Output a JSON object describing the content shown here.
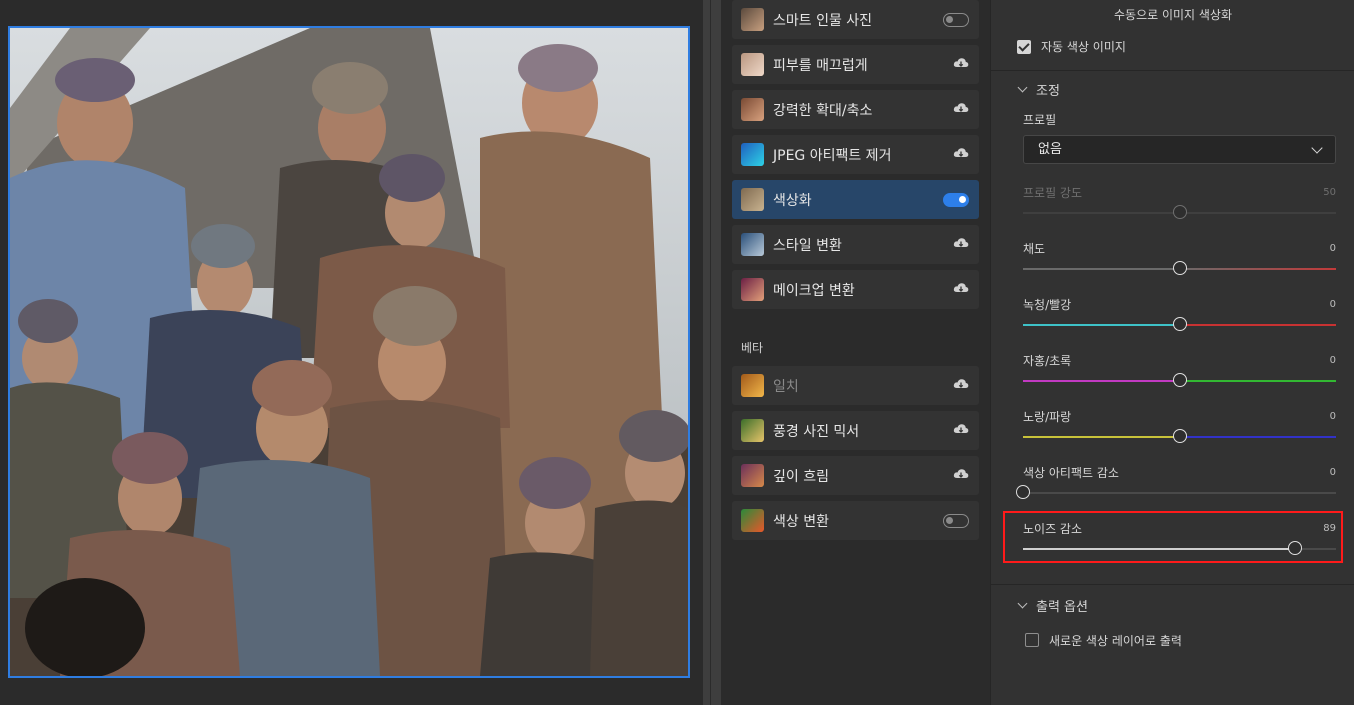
{
  "filters": [
    {
      "label": "스마트 인물 사진",
      "control": "toggle",
      "on": false,
      "thumb": [
        "#5b4a3d",
        "#c8a080"
      ]
    },
    {
      "label": "피부를 매끄럽게",
      "control": "cloud",
      "thumb": [
        "#b99680",
        "#efd9c9"
      ]
    },
    {
      "label": "강력한 확대/축소",
      "control": "cloud",
      "thumb": [
        "#7a4a34",
        "#d9a27f"
      ]
    },
    {
      "label": "JPEG 아티팩트 제거",
      "control": "cloud",
      "thumb": [
        "#1f5fbf",
        "#2ed2e6"
      ]
    },
    {
      "label": "색상화",
      "control": "toggle",
      "on": true,
      "active": true,
      "thumb": [
        "#7f6a50",
        "#c9b390"
      ]
    },
    {
      "label": "스타일 변환",
      "control": "cloud",
      "thumb": [
        "#2a4f7a",
        "#b8c9d8"
      ]
    },
    {
      "label": "메이크업 변환",
      "control": "cloud",
      "thumb": [
        "#6b1f44",
        "#e3a07a"
      ]
    }
  ],
  "beta_label": "베타",
  "beta_filters": [
    {
      "label": "일치",
      "control": "cloud",
      "disabled": true,
      "thumb": [
        "#a25a1a",
        "#f2b74a"
      ]
    },
    {
      "label": "풍경 사진 믹서",
      "control": "cloud",
      "thumb": [
        "#3b6e2a",
        "#e7c46a"
      ]
    },
    {
      "label": "깊이 흐림",
      "control": "cloud",
      "thumb": [
        "#6b2f5a",
        "#d78a4a"
      ]
    },
    {
      "label": "색상 변환",
      "control": "toggle",
      "on": false,
      "thumb": [
        "#2a8a3a",
        "#e8572a"
      ]
    }
  ],
  "panel": {
    "title": "수동으로 이미지 색상화",
    "auto_color_label": "자동 색상 이미지",
    "adjust_section": "조정",
    "profile_label": "프로필",
    "profile_value": "없음",
    "sliders": [
      {
        "label": "프로필 강도",
        "value": "50",
        "pos": 0.5,
        "disabled": true,
        "track": "plain"
      },
      {
        "label": "채도",
        "value": "0",
        "pos": 0.5,
        "track": "saturation"
      },
      {
        "label": "녹청/빨강",
        "value": "0",
        "pos": 0.5,
        "track": "cyan-red"
      },
      {
        "label": "자홍/초록",
        "value": "0",
        "pos": 0.5,
        "track": "magenta-green"
      },
      {
        "label": "노랑/파랑",
        "value": "0",
        "pos": 0.5,
        "track": "yellow-blue"
      },
      {
        "label": "색상 아티팩트 감소",
        "value": "0",
        "pos": 0.0,
        "track": "plain"
      },
      {
        "label": "노이즈 감소",
        "value": "89",
        "pos": 0.87,
        "track": "filled"
      }
    ],
    "output_section": "출력 옵션",
    "output_layer_label": "새로운 색상 레이어로 출력"
  },
  "colors": {
    "accent": "#2d7fea",
    "active_row": "#274669",
    "highlight": "#ff1a1a"
  }
}
